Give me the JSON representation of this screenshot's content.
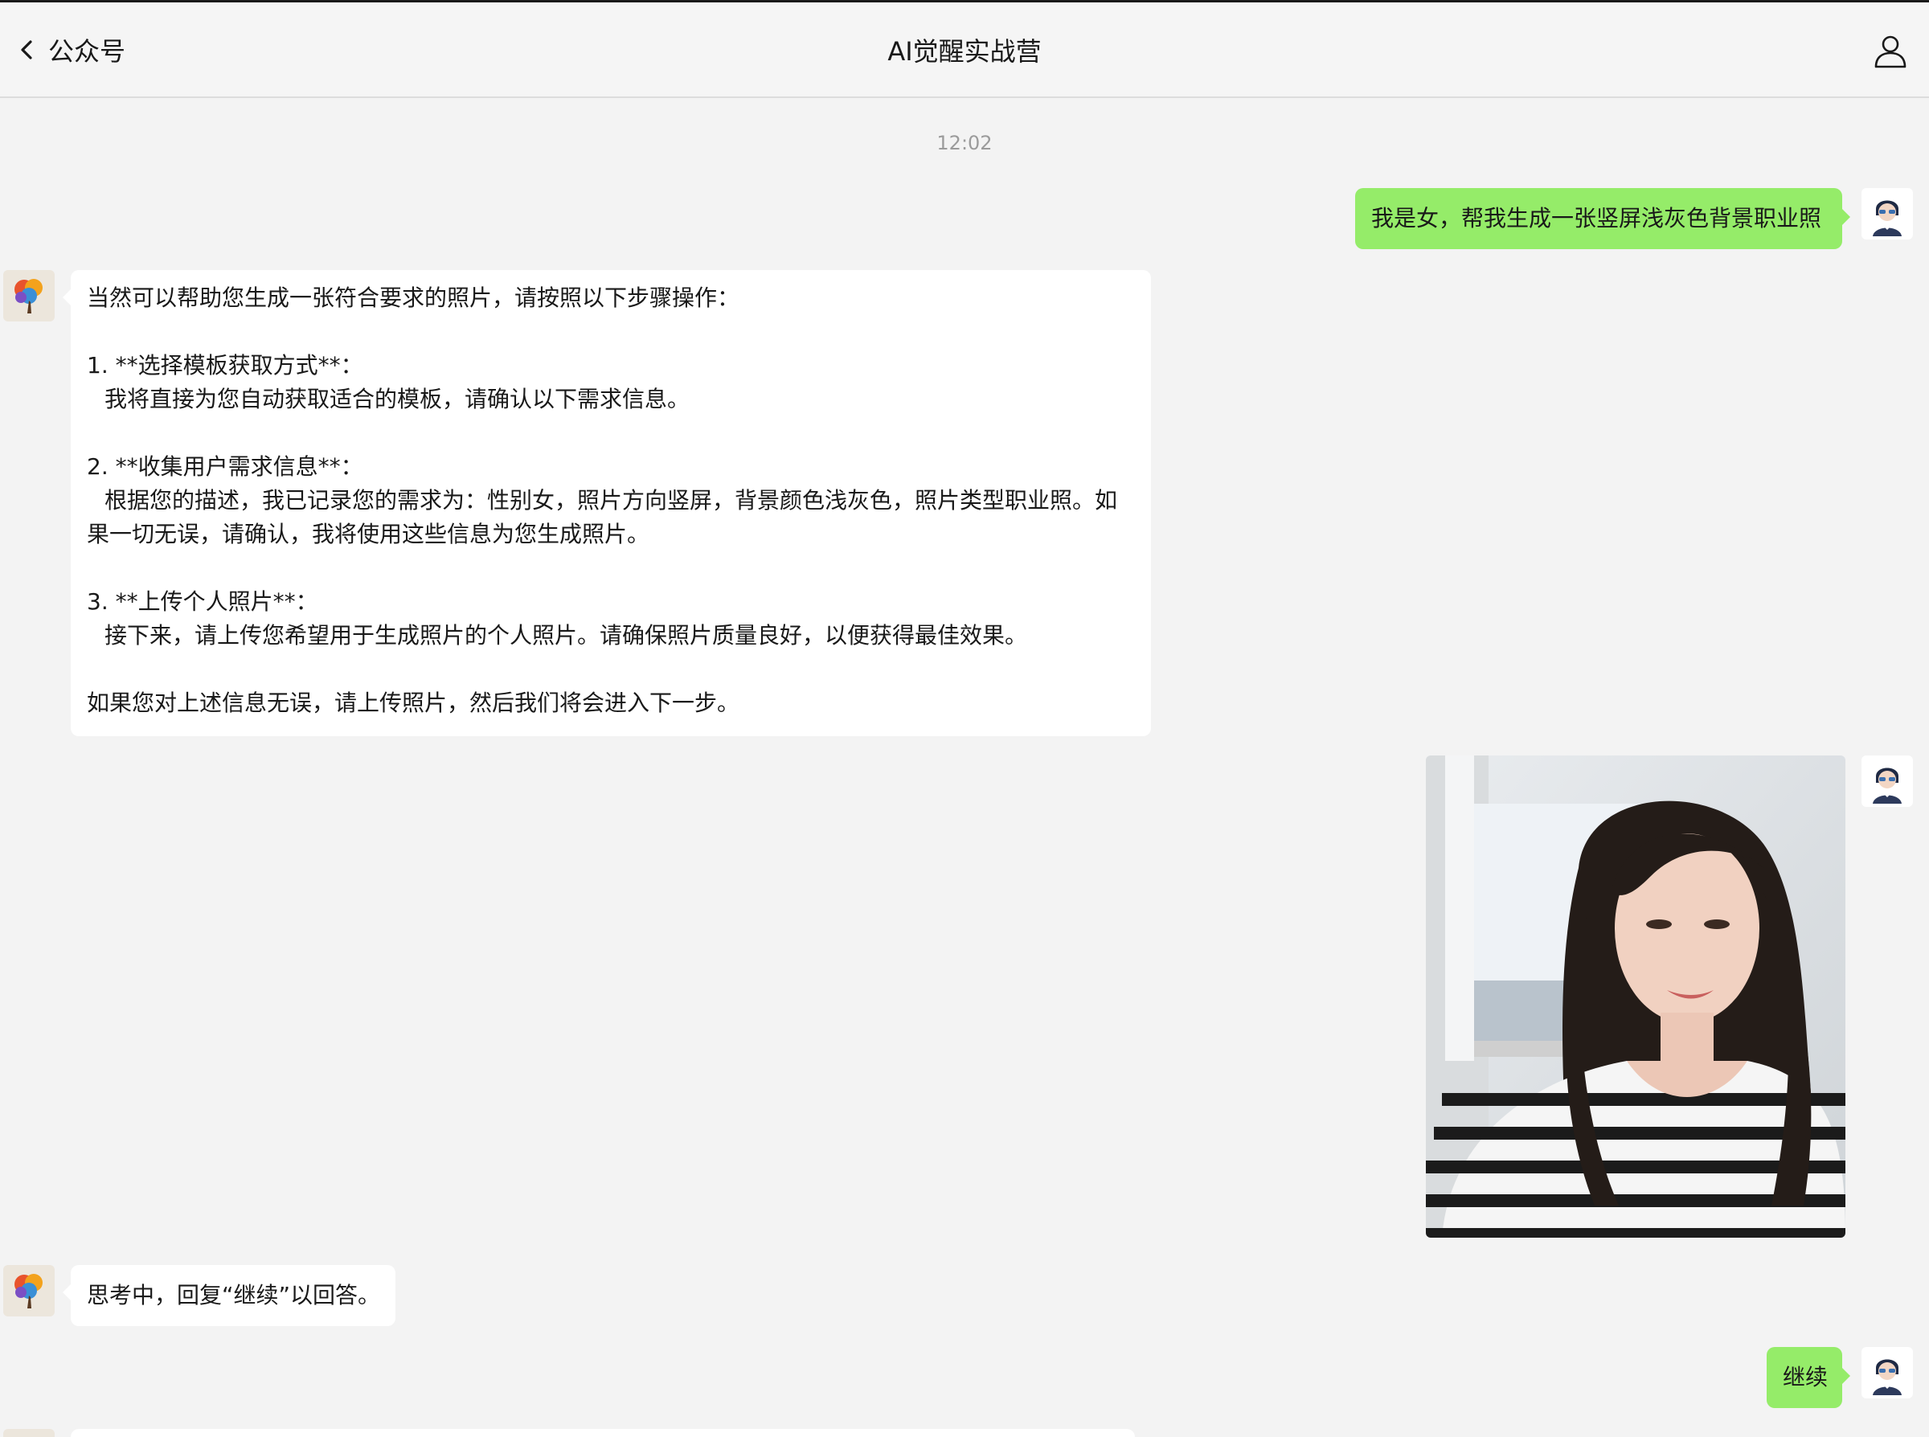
{
  "header": {
    "back_label": "公众号",
    "title": "AI觉醒实战营",
    "back_icon": "chevron-left-icon",
    "profile_icon": "person-icon"
  },
  "chat": {
    "timestamp": "12:02",
    "messages": [
      {
        "side": "right",
        "text": "我是女，帮我生成一张竖屏浅灰色背景职业照"
      },
      {
        "side": "left",
        "lines": [
          "当然可以帮助您生成一张符合要求的照片，请按照以下步骤操作：",
          "",
          "1. **选择模板获取方式**：",
          "我将直接为您自动获取适合的模板，请确认以下需求信息。",
          "",
          "2. **收集用户需求信息**：",
          "根据您的描述，我已记录您的需求为：性别女，照片方向竖屏，背景颜色浅灰色，照片类型职业照。如",
          "果一切无误，请确认，我将使用这些信息为您生成照片。",
          "",
          "3. **上传个人照片**：",
          "接下来，请上传您希望用于生成照片的个人照片。请确保照片质量良好，以便获得最佳效果。",
          "",
          "如果您对上述信息无误，请上传照片，然后我们将会进入下一步。"
        ]
      },
      {
        "side": "left",
        "text": "思考中，回复“继续”以回答。"
      },
      {
        "side": "right",
        "text": "继续"
      }
    ]
  },
  "colors": {
    "background": "#f3f3f3",
    "user_bubble": "#95ec69",
    "bot_bubble": "#ffffff",
    "timestamp": "#9b9b9b"
  }
}
